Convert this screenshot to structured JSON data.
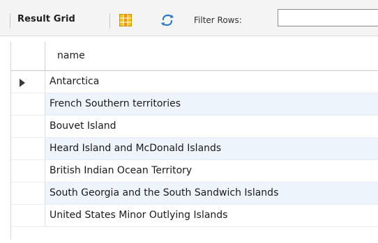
{
  "toolbar": {
    "result_grid_label": "Result Grid",
    "filter_label": "Filter Rows:",
    "filter_value": ""
  },
  "grid": {
    "column_header": "name",
    "rows": [
      "Antarctica",
      "French Southern territories",
      "Bouvet Island",
      "Heard Island and McDonald Islands",
      "British Indian Ocean Territory",
      "South Georgia and the South Sandwich Islands",
      "United States Minor Outlying Islands"
    ],
    "current_row_index": 0
  },
  "icons": {
    "grid_icon": "grid-layout-icon",
    "refresh_icon": "refresh-icon",
    "row_marker_icon": "current-row-arrow-icon"
  },
  "colors": {
    "toolbar_bg": "#f4f4f4",
    "row_alt_bg": "#eef4fc",
    "grid_icon_yellow": "#f2c316",
    "grid_icon_orange": "#e78d12",
    "refresh_blue": "#2f79c2"
  }
}
